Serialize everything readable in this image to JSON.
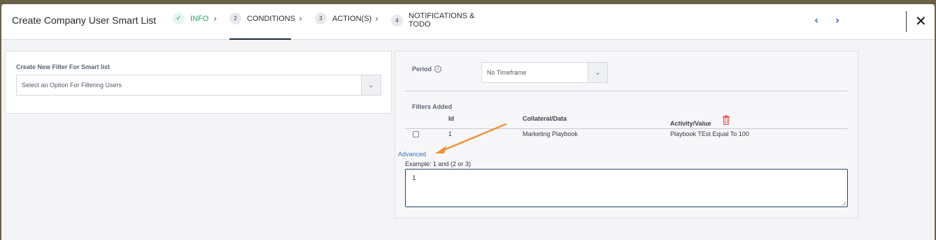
{
  "header": {
    "title": "Create Company User Smart List",
    "steps": [
      {
        "num": "✓",
        "label": "INFO",
        "state": "done"
      },
      {
        "num": "2",
        "label": "CONDITIONS",
        "state": "active"
      },
      {
        "num": "3",
        "label": "ACTION(S)",
        "state": "pending"
      },
      {
        "num": "4",
        "label": "NOTIFICATIONS &\nTODO",
        "state": "pending"
      }
    ],
    "prev_icon": "chevron-left-icon",
    "next_icon": "chevron-right-icon",
    "close_icon": "close-icon"
  },
  "left_panel": {
    "filter_label": "Create New Filter For Smart list",
    "filter_select_value": "Select an Option For Filtering Users"
  },
  "right_panel": {
    "period_label": "Period",
    "period_info_icon": "info-icon",
    "period_select_value": "No Timeframe",
    "filters_added_label": "Filters Added",
    "columns": {
      "id": "Id",
      "collateral": "Collateral/Data",
      "activity": "Activity/Value"
    },
    "delete_icon": "trash-icon",
    "rows": [
      {
        "id": "1",
        "collateral": "Marketing Playbook",
        "activity": "Playbook TEst Equal To 100"
      }
    ],
    "advanced_link": "Advanced",
    "example_text": "Example: 1 and (2 or 3)",
    "expression_value": "1"
  },
  "colors": {
    "accent_green": "#2aa764",
    "link_blue": "#3a6fb0",
    "arrow_orange": "#f0913a",
    "trash_red": "#d9534f"
  }
}
